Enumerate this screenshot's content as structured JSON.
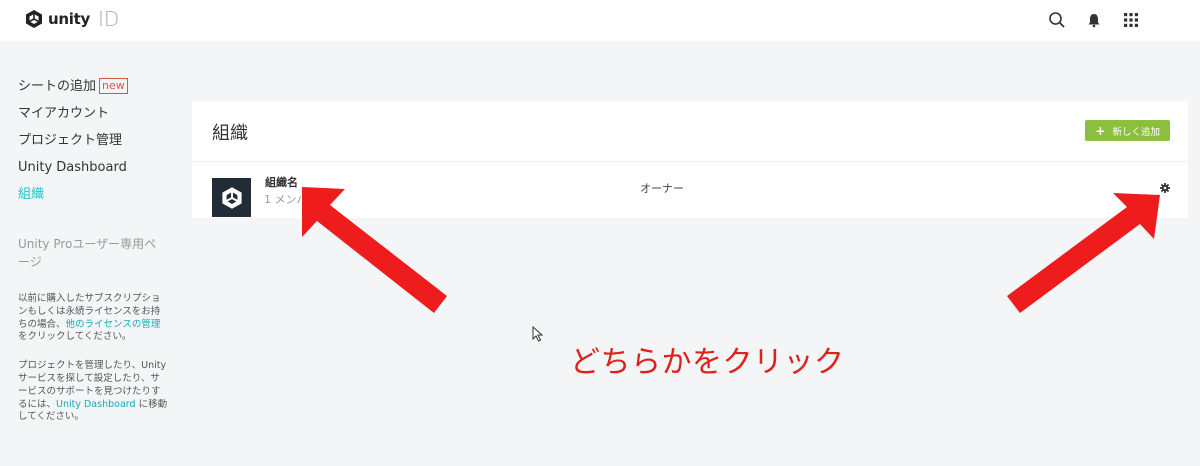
{
  "header": {
    "brand": "unity",
    "product": "ID",
    "icons": [
      "search-icon",
      "bell-icon",
      "apps-grid-icon"
    ]
  },
  "sidebar": {
    "items": [
      {
        "label": "シートの追加",
        "badge": "new"
      },
      {
        "label": "マイアカウント"
      },
      {
        "label": "プロジェクト管理"
      },
      {
        "label": "Unity Dashboard"
      },
      {
        "label": "組織",
        "active": true
      }
    ],
    "pro_label": "Unity Proユーザー専用ページ",
    "para1": {
      "text": "以前に購入したサブスクリプションもしくは永続ライセンスをお持ちの場合、",
      "link": "他のライセンスの管理",
      "suffix": "をクリックしてください。"
    },
    "para2": {
      "text": "プロジェクトを管理したり、Unity サービスを探して設定したり、サービスのサポートを見つけたりするには、",
      "link": "Unity Dashboard",
      "suffix": " に移動してください。"
    }
  },
  "main": {
    "title": "組織",
    "add_button": "新しく追加",
    "org": {
      "name": "組織名",
      "members": "1 メンバ",
      "role": "オーナー"
    }
  },
  "annotation": {
    "text": "どちらかをクリック",
    "color": "#e0201a"
  },
  "colors": {
    "accent": "#19c3cf",
    "add_button": "#8cbf3f",
    "badge": "#d9534f",
    "org_logo_bg": "#222c37"
  }
}
